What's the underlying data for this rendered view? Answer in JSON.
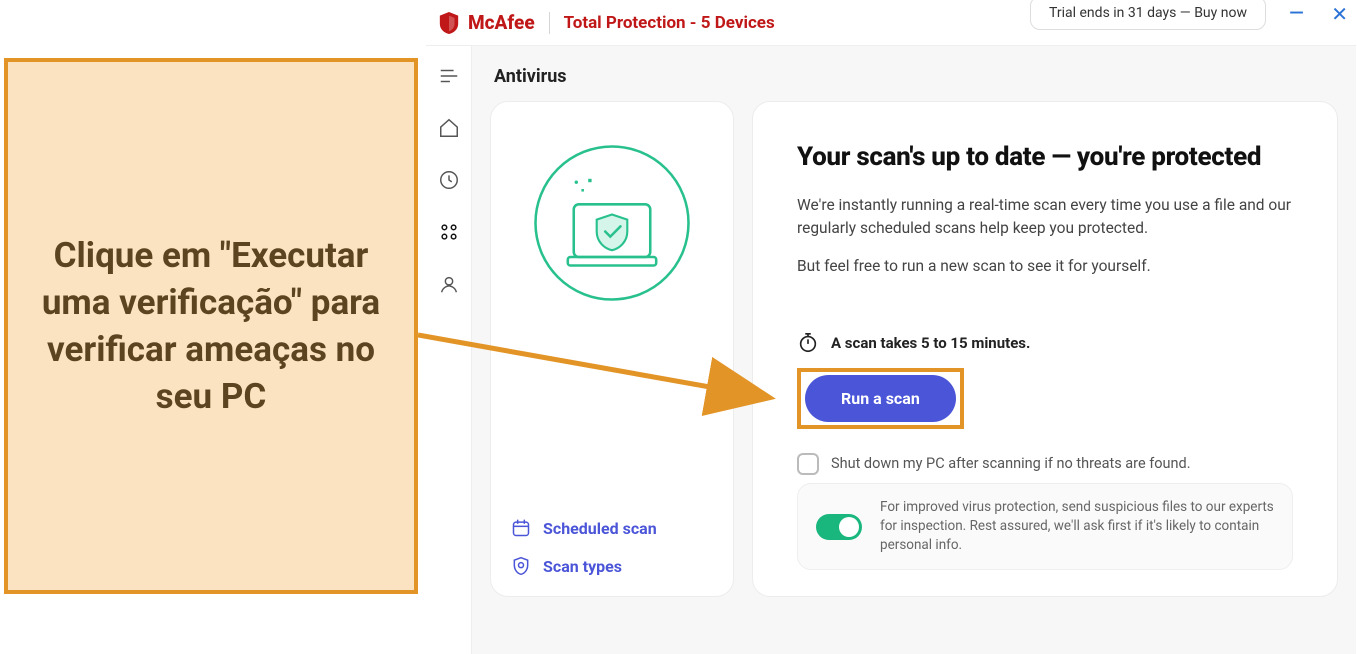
{
  "callout": {
    "text": "Clique em \"Executar uma verificação\" para verificar ameaças no seu PC"
  },
  "titlebar": {
    "brand": "McAfee",
    "product": "Total Protection - 5 Devices",
    "trial_text": "Trial ends in 31 days — Buy now"
  },
  "page": {
    "title": "Antivirus"
  },
  "left_card": {
    "links": {
      "scheduled": "Scheduled scan",
      "types": "Scan types"
    }
  },
  "right_card": {
    "heading": "Your scan's up to date — you're protected",
    "body1": "We're instantly running a real-time scan every time you use a file and our regularly scheduled scans help keep you protected.",
    "body2": "But feel free to run a new scan to see it for yourself.",
    "timer_text": "A scan takes 5 to 15 minutes.",
    "run_label": "Run a scan",
    "shutdown_label": "Shut down my PC after scanning if no threats are found.",
    "info_text": "For improved virus protection, send suspicious files to our experts for inspection. Rest assured, we'll ask first if it's likely to contain personal info."
  },
  "colors": {
    "brand_red": "#c01818",
    "primary_blue": "#4b55d8",
    "annotation_orange": "#e39426",
    "toggle_green": "#19b77e"
  }
}
